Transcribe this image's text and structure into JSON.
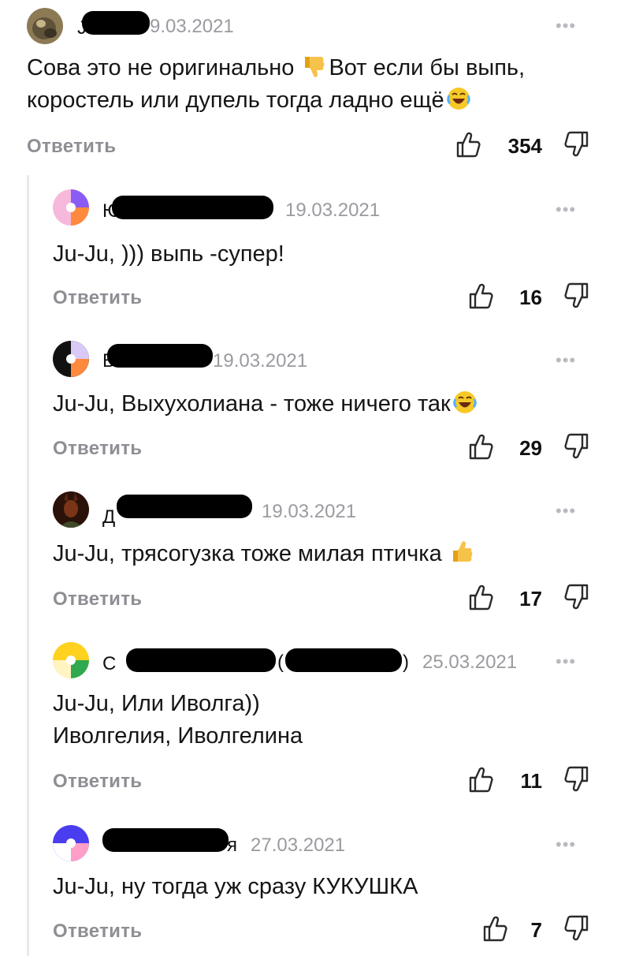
{
  "colors": {
    "date": "#9a9aa0",
    "reply": "#8e8e94",
    "thread_line": "#e9e9ec"
  },
  "comments": [
    {
      "name_fragment": "J",
      "date": "9.03.2021",
      "text_lines": [
        "Сова это не оригинально",
        "Вот если бы выпь,",
        "коростель или дупель тогда ладно ещё"
      ],
      "reply_label": "Ответить",
      "likes": "354"
    },
    {
      "name_fragment": "Ю",
      "date": "19.03.2021",
      "text_lines": [
        "Ju-Ju, ))) выпь -супер!"
      ],
      "reply_label": "Ответить",
      "likes": "16"
    },
    {
      "name_fragment": "Б",
      "date": "19.03.2021",
      "text_lines": [
        "Ju-Ju, Выхухолиана - тоже ничего так"
      ],
      "reply_label": "Ответить",
      "likes": "29"
    },
    {
      "name_fragment": "Д",
      "date": "19.03.2021",
      "text_lines": [
        "Ju-Ju, трясогузка тоже милая птичка"
      ],
      "reply_label": "Ответить",
      "likes": "17"
    },
    {
      "name_fragment": "С",
      "name_paren_open": "(",
      "name_paren_close": ")",
      "date": "25.03.2021",
      "text_lines": [
        "Ju-Ju, Или Иволга))",
        "Иволгелия, Иволгелина"
      ],
      "reply_label": "Ответить",
      "likes": "11"
    },
    {
      "name_fragment_end": "я",
      "date": "27.03.2021",
      "text_lines": [
        "Ju-Ju, ну тогда уж сразу КУКУШКА"
      ],
      "reply_label": "Ответить",
      "likes": "7"
    }
  ]
}
